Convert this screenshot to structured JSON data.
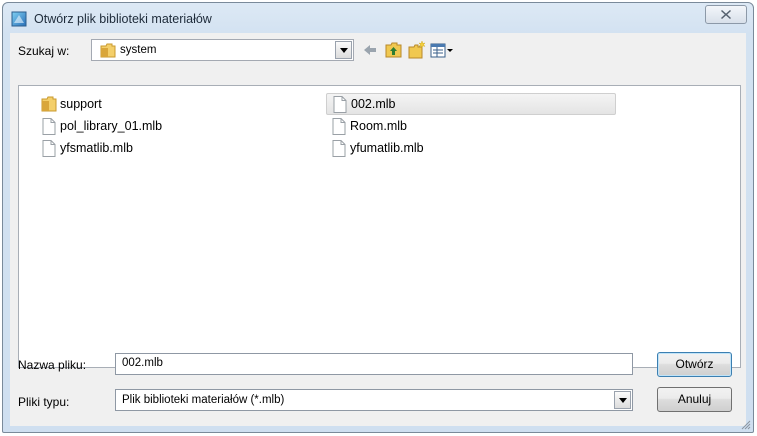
{
  "window": {
    "title": "Otwórz plik biblioteki materiałów",
    "close_label": "X"
  },
  "lookin": {
    "label": "Szukaj w:",
    "value": "system",
    "icon": "folder-icon"
  },
  "toolbar": {
    "icons": [
      "back-arrow-icon",
      "up-folder-icon",
      "new-folder-icon",
      "view-menu-icon"
    ]
  },
  "files": [
    {
      "name": "support",
      "type": "folder"
    },
    {
      "name": "pol_library_01.mlb",
      "type": "file"
    },
    {
      "name": "yfsmatlib.mlb",
      "type": "file"
    },
    {
      "name": "002.mlb",
      "type": "file",
      "selected": true
    },
    {
      "name": "Room.mlb",
      "type": "file"
    },
    {
      "name": "yfumatlib.mlb",
      "type": "file"
    }
  ],
  "filename": {
    "label": "Nazwa pliku:",
    "value": "002.mlb"
  },
  "filetype": {
    "label": "Pliki typu:",
    "value": "Plik biblioteki materiałów (*.mlb)"
  },
  "buttons": {
    "open": "Otwórz",
    "cancel": "Anuluj"
  },
  "colors": {
    "title_bar": "#d3e2f1",
    "client_bg": "#f0f0f0",
    "folder": "#e8b84a"
  }
}
